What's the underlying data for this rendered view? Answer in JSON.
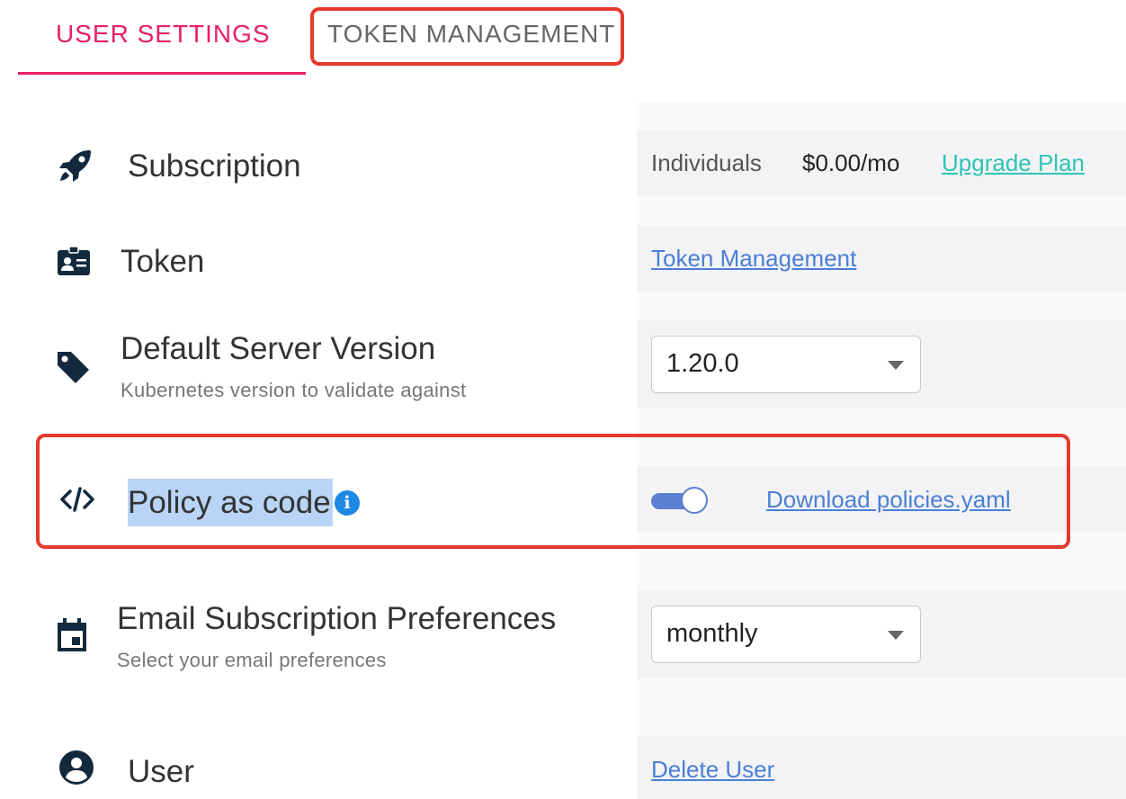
{
  "tabs": {
    "user_settings": "USER SETTINGS",
    "token_management": "TOKEN MANAGEMENT"
  },
  "rows": {
    "subscription": {
      "label": "Subscription",
      "plan": "Individuals",
      "price": "$0.00/mo",
      "upgrade_link": "Upgrade Plan"
    },
    "token": {
      "label": "Token",
      "link": "Token Management"
    },
    "server_version": {
      "label": "Default Server Version",
      "sublabel": "Kubernetes version to validate against",
      "selected": "1.20.0"
    },
    "policy": {
      "label": "Policy as code",
      "info": "i",
      "toggle_on": true,
      "download_link": "Download policies.yaml"
    },
    "email": {
      "label": "Email Subscription Preferences",
      "sublabel": "Select your email preferences",
      "selected": "monthly"
    },
    "user": {
      "label": "User",
      "link": "Delete User"
    }
  },
  "colors": {
    "accent": "#e8205f",
    "highlight_box": "#e43a2e",
    "link": "#4a7fd6",
    "upgrade": "#2ec4b6",
    "toggle": "#5b7fd1",
    "icon": "#13293d"
  }
}
